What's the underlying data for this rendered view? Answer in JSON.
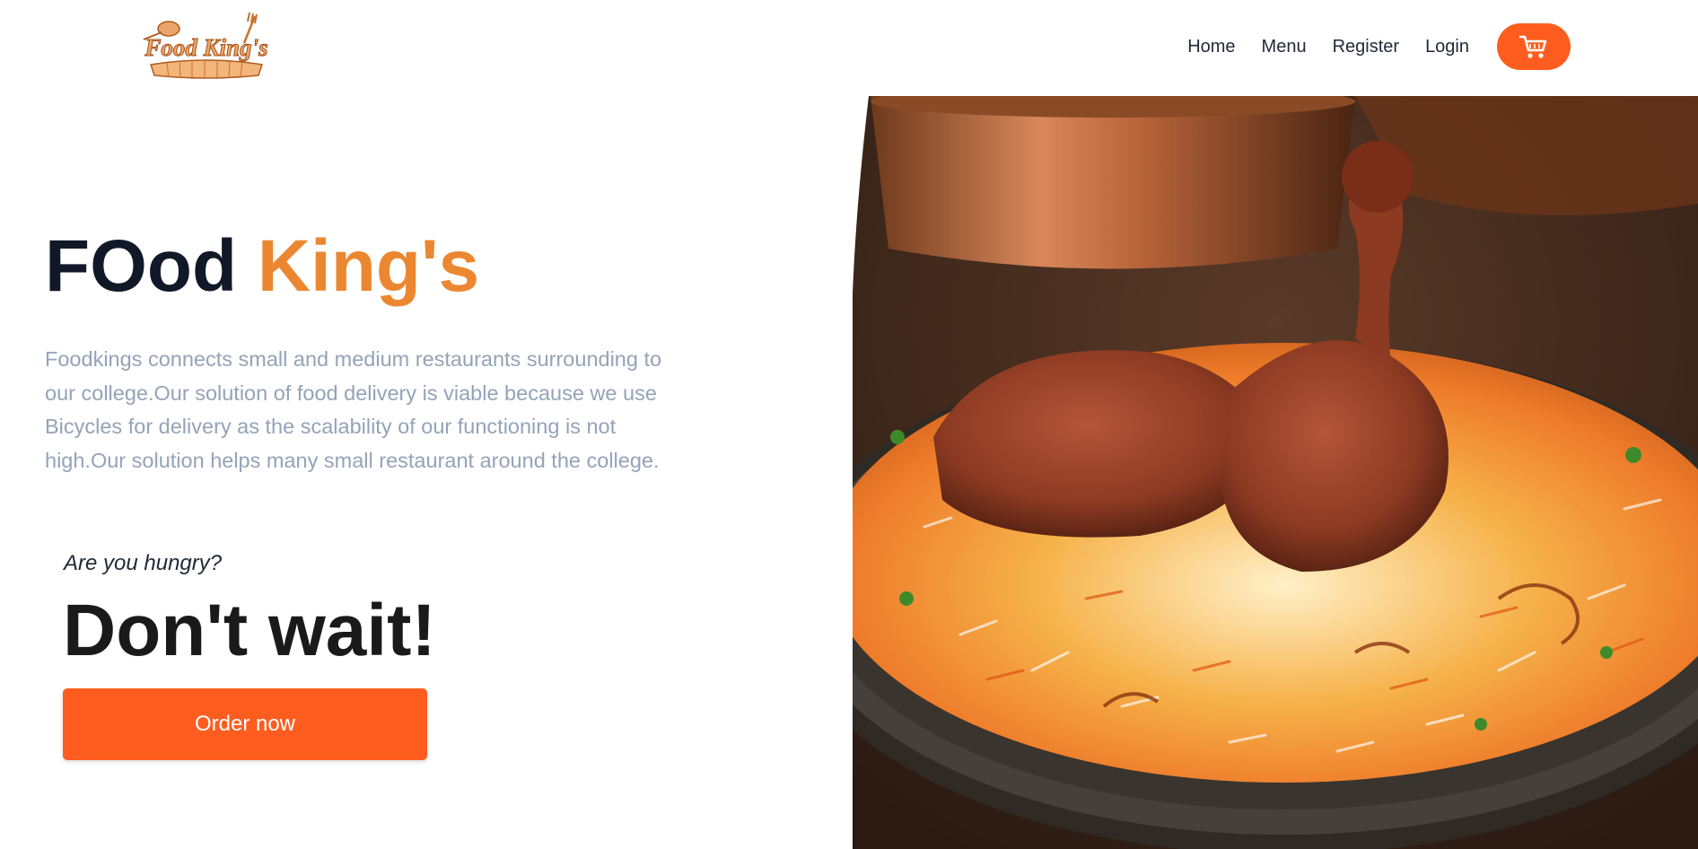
{
  "header": {
    "logo_text": "Food King's",
    "nav": [
      {
        "label": "Home"
      },
      {
        "label": "Menu"
      },
      {
        "label": "Register"
      },
      {
        "label": "Login"
      }
    ],
    "cart_icon": "shopping-cart-icon"
  },
  "hero": {
    "title_part1": "FOod ",
    "title_part2": "King's",
    "description": "Foodkings connects small and medium restaurants surrounding to our college.Our solution of food delivery is viable because we use Bicycles for delivery as the scalability of our functioning is not high.Our solution helps many small restaurant around the college.",
    "tagline": "Are you hungry?",
    "headline": "Don't wait!",
    "cta_label": "Order now"
  },
  "colors": {
    "accent": "#fe5d1f",
    "title_accent": "#ec8731",
    "description": "#94a3b8"
  }
}
